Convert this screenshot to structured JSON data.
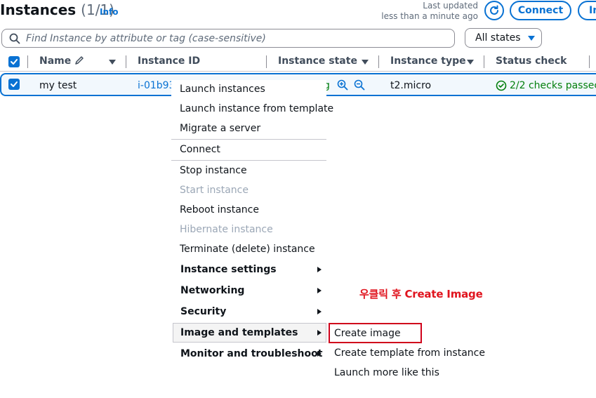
{
  "header": {
    "title": "Instances",
    "count": "(1/1)",
    "info": "Info",
    "last_updated_line1": "Last updated",
    "last_updated_line2": "less than a minute ago",
    "connect_label": "Connect",
    "instance_state_label": "Instance state"
  },
  "search": {
    "placeholder": "Find Instance by attribute or tag (case-sensitive)"
  },
  "filter": {
    "selected": "All states"
  },
  "table": {
    "columns": [
      "Name",
      "Instance ID",
      "Instance state",
      "Instance type",
      "Status check"
    ],
    "row": {
      "name": "my test",
      "instance_id": "i-01b93",
      "state_fragment": "g",
      "instance_type": "t2.micro",
      "status_check": "2/2 checks passec"
    }
  },
  "context_menu": {
    "items": [
      {
        "label": "Launch instances"
      },
      {
        "label": "Launch instance from template"
      },
      {
        "label": "Migrate a server"
      },
      {
        "label": "Connect"
      },
      {
        "label": "Stop instance"
      },
      {
        "label": "Start instance",
        "disabled": true
      },
      {
        "label": "Reboot instance"
      },
      {
        "label": "Hibernate instance",
        "disabled": true
      },
      {
        "label": "Terminate (delete) instance"
      },
      {
        "label": "Instance settings",
        "submenu": true
      },
      {
        "label": "Networking",
        "submenu": true
      },
      {
        "label": "Security",
        "submenu": true
      },
      {
        "label": "Image and templates",
        "submenu": true,
        "active": true
      },
      {
        "label": "Monitor and troubleshoot",
        "submenu": true
      }
    ]
  },
  "submenu": {
    "items": [
      {
        "label": "Create image",
        "highlighted": true
      },
      {
        "label": "Create template from instance"
      },
      {
        "label": "Launch more like this"
      }
    ]
  },
  "annotation": {
    "text": "우클릭 후 Create Image"
  },
  "colors": {
    "accent": "#0972d3",
    "success": "#037f0c",
    "annotation": "#e0141e",
    "disabled": "#9ba7b6"
  }
}
